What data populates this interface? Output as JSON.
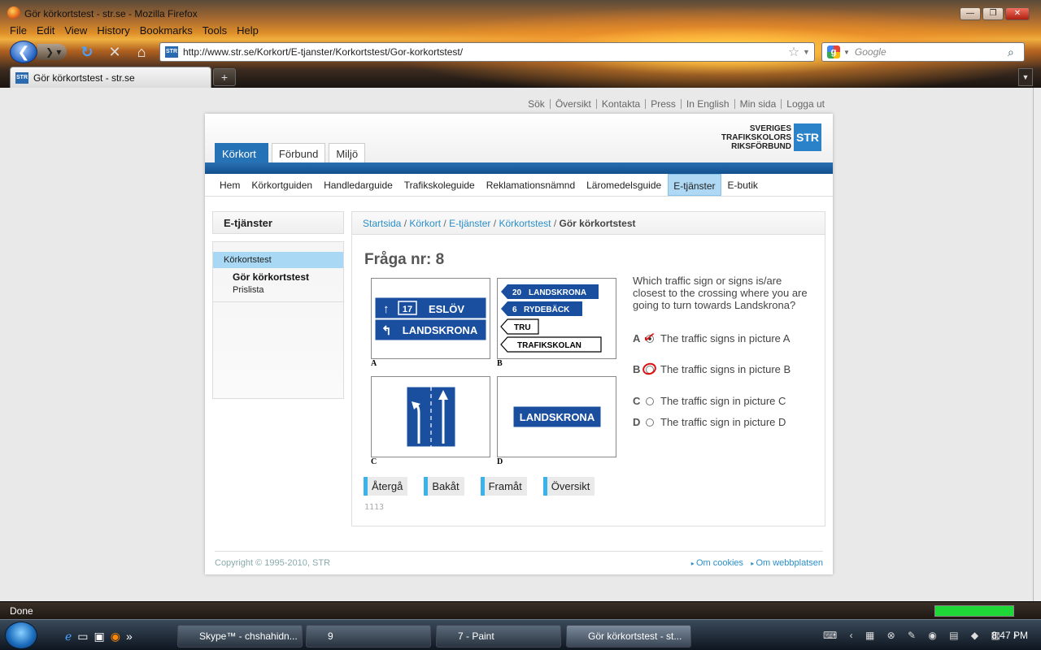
{
  "window": {
    "title": "Gör körkortstest - str.se - Mozilla Firefox"
  },
  "menu": [
    "File",
    "Edit",
    "View",
    "History",
    "Bookmarks",
    "Tools",
    "Help"
  ],
  "url": "http://www.str.se/Korkort/E-tjanster/Korkortstest/Gor-korkortstest/",
  "search_placeholder": "Google",
  "tab": {
    "title": "Gör körkortstest - str.se",
    "favicon_text": "STR"
  },
  "top_links": [
    "Sök",
    "Översikt",
    "Kontakta",
    "Press",
    "In English",
    "Min sida",
    "Logga ut"
  ],
  "logo": {
    "line1": "SVERIGES",
    "line2": "TRAFIKSKOLORS",
    "line3": "RIKSFÖRBUND",
    "mark": "STR"
  },
  "main_tabs": [
    "Körkort",
    "Förbund",
    "Miljö"
  ],
  "subnav": [
    "Hem",
    "Körkortguiden",
    "Handledarguide",
    "Trafikskoleguide",
    "Reklamationsnämnd",
    "Läromedelsguide",
    "E-tjänster",
    "E-butik"
  ],
  "sidebar": {
    "heading": "E-tjänster",
    "section": "Körkortstest",
    "items": [
      "Gör körkortstest",
      "Prislista"
    ]
  },
  "breadcrumb": {
    "items": [
      "Startsida",
      "Körkort",
      "E-tjänster",
      "Körkortstest"
    ],
    "current": "Gör körkortstest"
  },
  "question": {
    "title": "Fråga nr: 8",
    "text": "Which traffic sign or signs is/are closest to the crossing where you are going to turn towards Landskrona?",
    "answers": [
      {
        "letter": "A",
        "text": "The traffic signs in picture A"
      },
      {
        "letter": "B",
        "text": "The traffic signs in picture B"
      },
      {
        "letter": "C",
        "text": "The traffic sign in picture C"
      },
      {
        "letter": "D",
        "text": "The traffic sign in picture D"
      }
    ]
  },
  "pictures": {
    "a": {
      "label": "A",
      "sign1_num": "17",
      "sign1_text": "ESLÖV",
      "sign2_text": "LANDSKRONA"
    },
    "b": {
      "label": "B",
      "s1_num": "20",
      "s1_text": "LANDSKRONA",
      "s2_num": "6",
      "s2_text": "RYDEBÄCK",
      "s3_text": "TRU",
      "s4_text": "TRAFIKSKOLAN"
    },
    "c": {
      "label": "C"
    },
    "d": {
      "label": "D",
      "text": "LANDSKRONA"
    }
  },
  "buttons": [
    "Återgå",
    "Bakåt",
    "Framåt",
    "Översikt"
  ],
  "code": "1113",
  "footer": {
    "copyright": "Copyright © 1995-2010, STR",
    "links": [
      "Om cookies",
      "Om webbplatsen"
    ]
  },
  "status": "Done",
  "taskbar": {
    "tasks": [
      "Skype™ - chshahidn...",
      "9",
      "7 - Paint",
      "Gör körkortstest - st..."
    ],
    "clock": "8:47 PM"
  },
  "colors": {
    "brand_blue": "#2572b6",
    "sign_blue": "#1a4fa0",
    "highlight": "#aed8f3",
    "mark_red": "#d11111"
  }
}
